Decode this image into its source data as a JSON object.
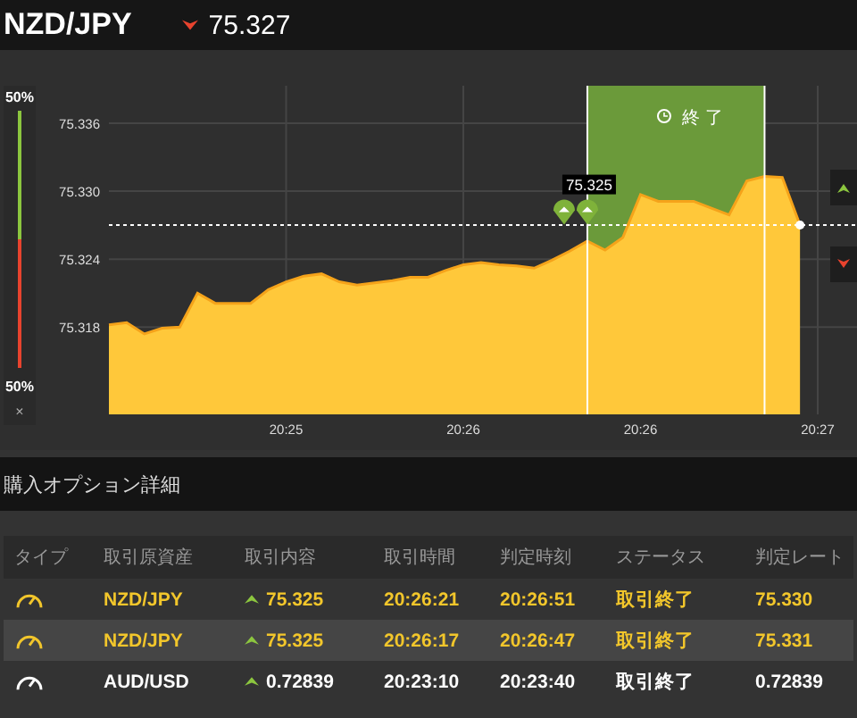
{
  "header": {
    "symbol": "NZD/JPY",
    "rising": false,
    "price": "75.327"
  },
  "sentiment": {
    "top_label": "50%",
    "bottom_label": "50%",
    "level": 0.5,
    "close": "×"
  },
  "chart": {
    "expiry_label": "終了",
    "entry_tooltip": "75.325",
    "chart_data": {
      "type": "area",
      "grid": true,
      "ylim": [
        75.3103,
        75.3393
      ],
      "categories": [
        null,
        null,
        null,
        null,
        null,
        null,
        null,
        null,
        null,
        null,
        "20:25",
        null,
        null,
        null,
        null,
        null,
        null,
        null,
        null,
        null,
        "20:26",
        null,
        null,
        null,
        null,
        null,
        null,
        null,
        null,
        null,
        "20:26",
        null,
        null,
        null,
        null,
        null,
        null,
        null,
        null,
        null,
        "20:27"
      ],
      "series": [
        {
          "color": "#ffc83a",
          "values": [
            75.3182,
            75.3184,
            75.3174,
            75.3179,
            75.318,
            75.321,
            75.3201,
            75.3201,
            75.3201,
            75.3213,
            75.322,
            75.3225,
            75.3227,
            75.322,
            75.3217,
            75.3219,
            75.3221,
            75.3224,
            75.3224,
            75.323,
            75.3235,
            75.3237,
            75.3235,
            75.3234,
            75.3232,
            75.3239,
            75.3247,
            75.3256,
            75.3248,
            75.3259,
            75.3297,
            75.3291,
            75.3291,
            75.3291,
            75.3285,
            75.3279,
            75.3309,
            75.3313,
            75.3312,
            75.327,
            null
          ]
        }
      ],
      "yticks": [
        {
          "value": 75.318,
          "label": "75.318"
        },
        {
          "value": 75.324,
          "label": "75.324"
        },
        {
          "value": 75.33,
          "label": "75.330"
        },
        {
          "value": 75.336,
          "label": "75.336"
        }
      ],
      "ref_lines": [
        {
          "axis": "y",
          "value": 75.327
        }
      ]
    }
  },
  "details_title": "購入オプション詳細",
  "table": {
    "columns": [
      "タイプ",
      "取引原資産",
      "取引内容",
      "取引時間",
      "判定時刻",
      "ステータス",
      "判定レート"
    ],
    "rows": [
      {
        "asset": "NZD/JPY",
        "rising": true,
        "price": "75.325",
        "entry_time": "20:26:21",
        "expiry_time": "20:26:51",
        "status": "取引終了",
        "rate": "75.330",
        "highlighted": true,
        "selected": false
      },
      {
        "asset": "NZD/JPY",
        "rising": true,
        "price": "75.325",
        "entry_time": "20:26:17",
        "expiry_time": "20:26:47",
        "status": "取引終了",
        "rate": "75.331",
        "highlighted": true,
        "selected": true
      },
      {
        "asset": "AUD/USD",
        "rising": true,
        "price": "0.72839",
        "entry_time": "20:23:10",
        "expiry_time": "20:23:40",
        "status": "取引終了",
        "rate": "0.72839",
        "highlighted": false,
        "selected": false
      }
    ]
  }
}
